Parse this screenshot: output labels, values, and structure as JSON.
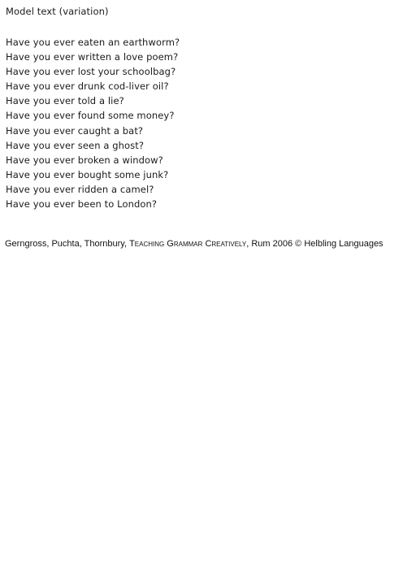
{
  "document": {
    "title": "Model text (variation)",
    "questions": [
      "Have you ever eaten an earthworm?",
      "Have you ever written a love poem?",
      "Have you ever lost your schoolbag?",
      "Have you ever drunk cod-liver oil?",
      "Have you ever told a lie?",
      "Have you ever found some money?",
      "Have you ever caught a bat?",
      "Have you ever seen a ghost?",
      "Have you ever broken a window?",
      "Have you ever bought some junk?",
      "Have you ever ridden a camel?",
      "Have you ever been to London?"
    ]
  },
  "credit": {
    "authors": "Gerngross, Puchta, Thornbury, ",
    "book_title": "Teaching Grammar Creatively",
    "rest": ", Rum 2006 © Helbling Languages"
  }
}
